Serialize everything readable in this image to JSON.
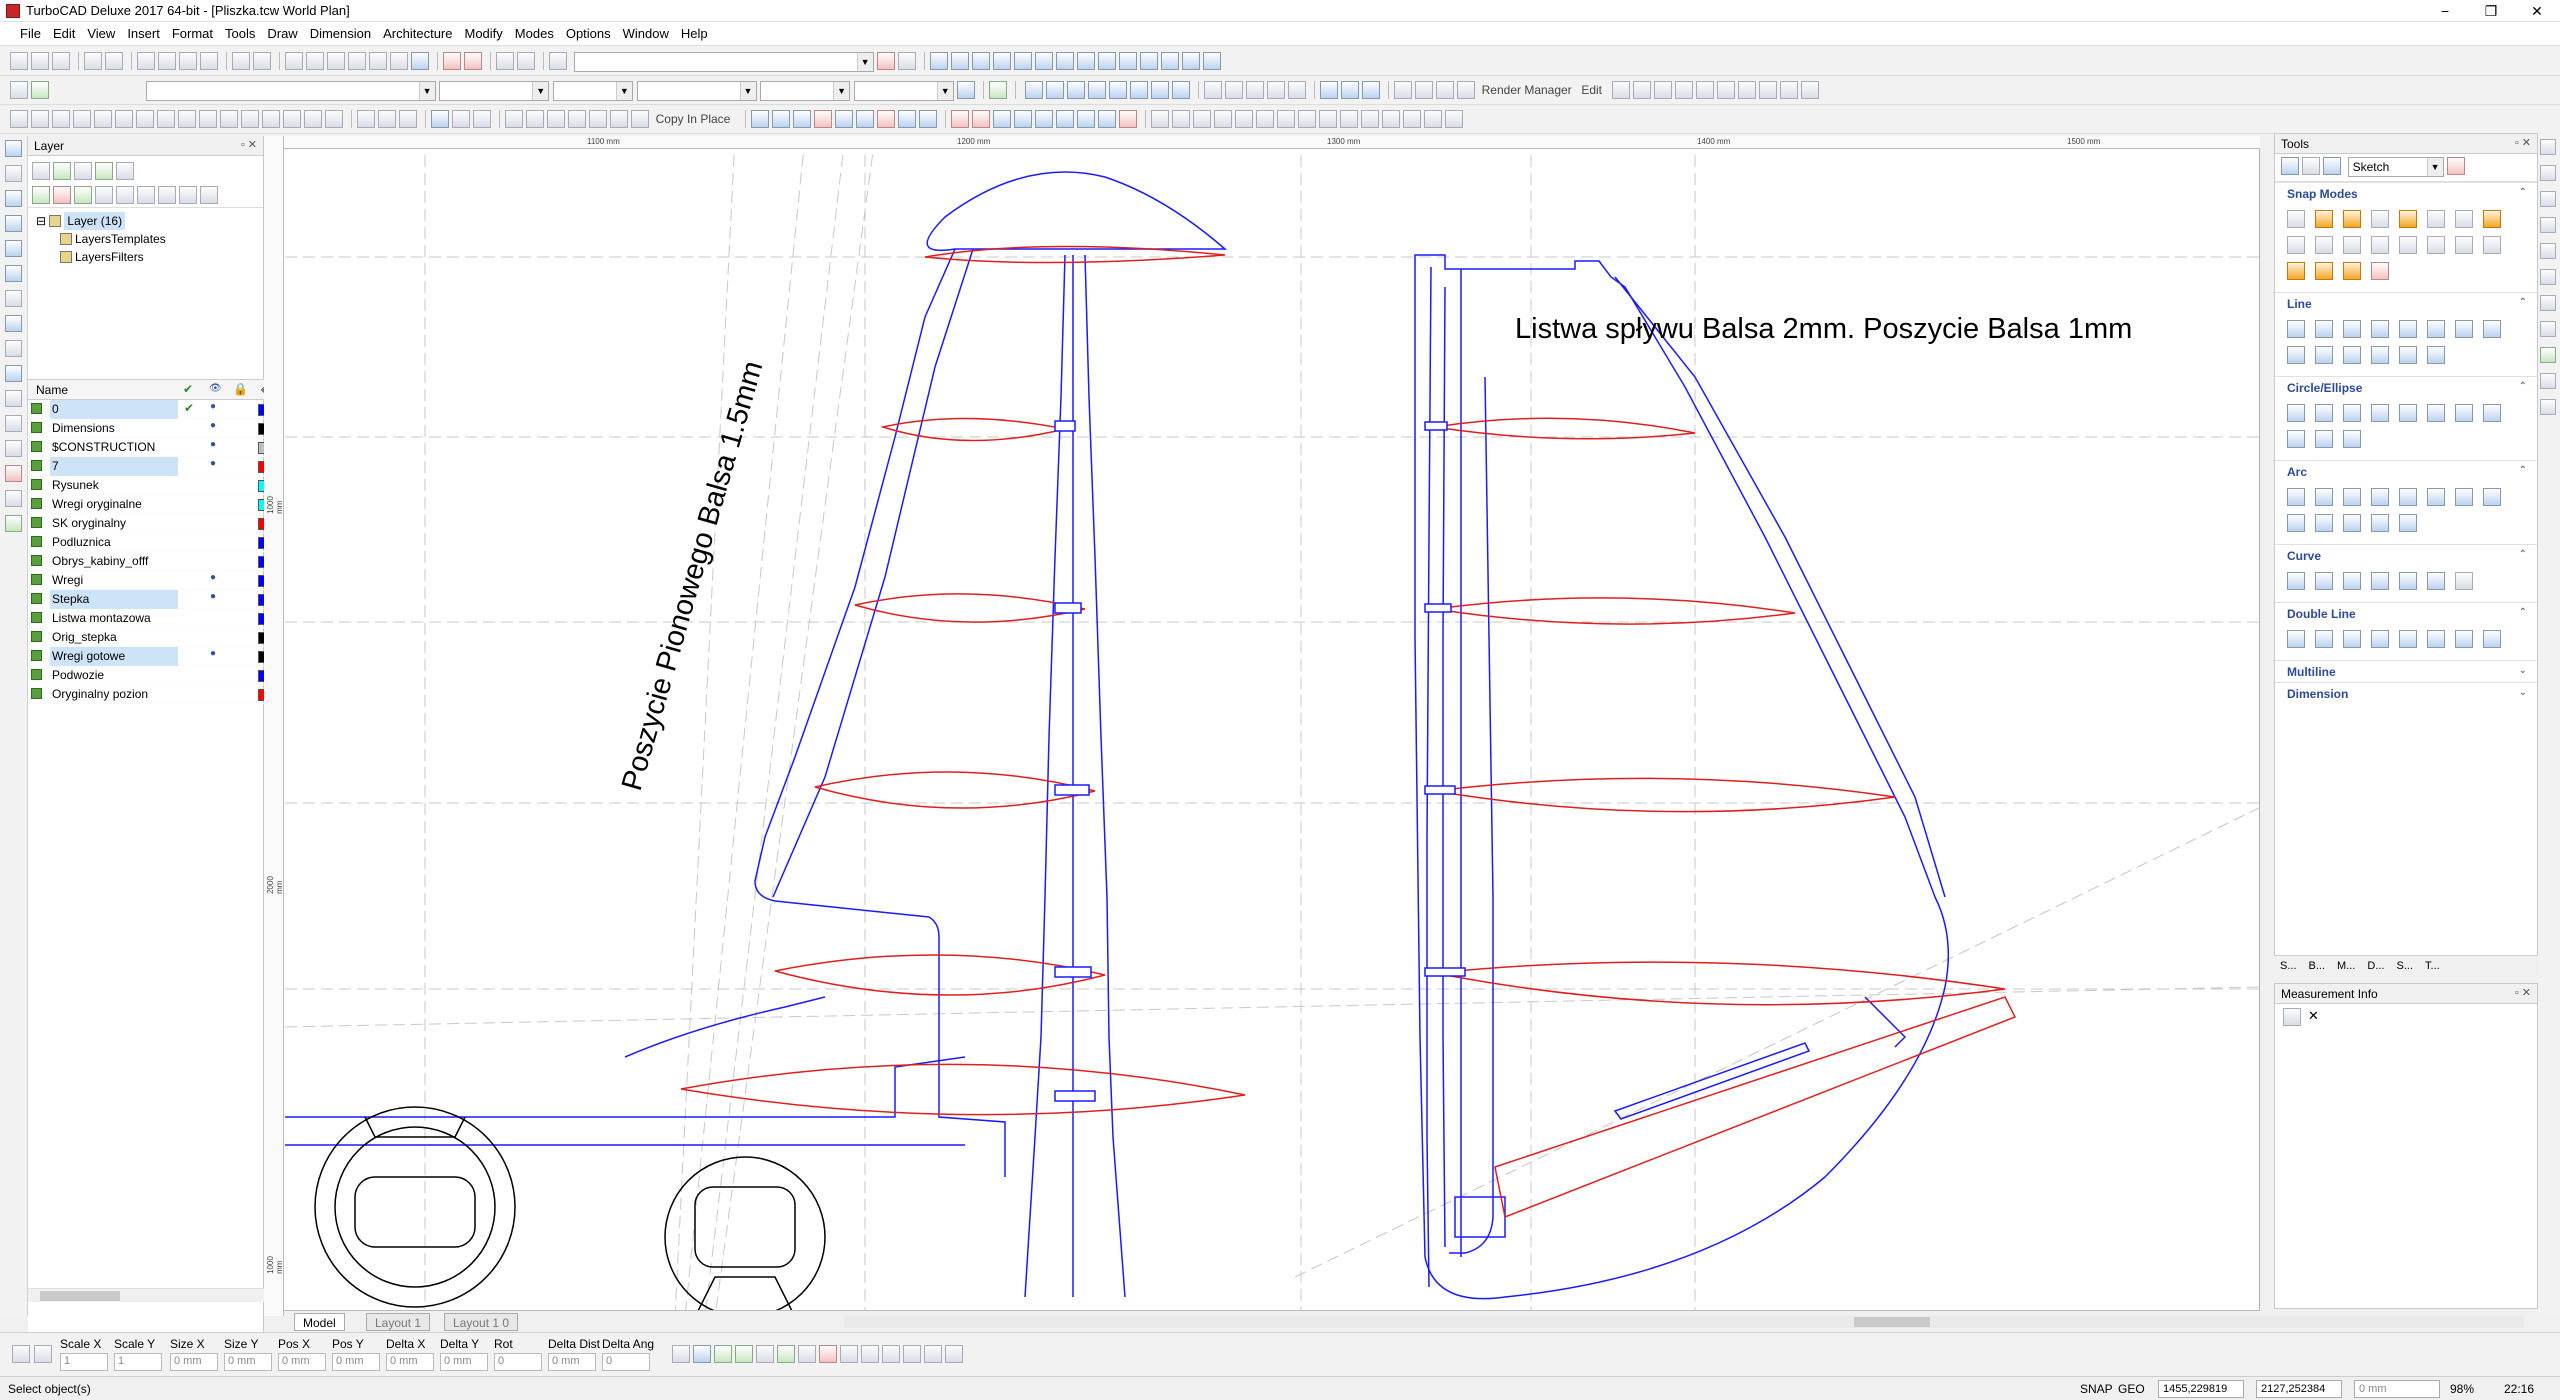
{
  "window": {
    "title": "TurboCAD Deluxe 2017 64-bit - [Pliszka.tcw World Plan]",
    "controls": [
      "−",
      "❐",
      "✕"
    ]
  },
  "menu": [
    "File",
    "Edit",
    "View",
    "Insert",
    "Format",
    "Tools",
    "Draw",
    "Dimension",
    "Architecture",
    "Modify",
    "Modes",
    "Options",
    "Window",
    "Help"
  ],
  "toolbars": {
    "render_manager_label": "Render Manager",
    "edit_label": "Edit",
    "copy_in_place_label": "Copy In Place"
  },
  "layer_panel": {
    "title": "Layer",
    "tree": {
      "root": "Layer (16)",
      "children": [
        "LayersTemplates",
        "LayersFilters"
      ]
    },
    "columns": {
      "name": "Name"
    },
    "layers": [
      {
        "name": "0",
        "checked": true,
        "visible": true,
        "color": "#0000ff",
        "highlight": true
      },
      {
        "name": "Dimensions",
        "checked": false,
        "visible": true,
        "color": "#000000",
        "highlight": false
      },
      {
        "name": "$CONSTRUCTION",
        "checked": false,
        "visible": true,
        "color": "#c0c0c0",
        "highlight": false
      },
      {
        "name": "7",
        "checked": false,
        "visible": true,
        "color": "#ff0000",
        "highlight": true
      },
      {
        "name": "Rysunek",
        "checked": false,
        "visible": false,
        "color": "#00ffff",
        "highlight": false
      },
      {
        "name": "Wregi oryginalne",
        "checked": false,
        "visible": false,
        "color": "#00ffff",
        "highlight": false
      },
      {
        "name": "SK oryginalny",
        "checked": false,
        "visible": false,
        "color": "#ff0000",
        "highlight": false
      },
      {
        "name": "Podluznica",
        "checked": false,
        "visible": false,
        "color": "#0000ff",
        "highlight": false
      },
      {
        "name": "Obrys_kabiny_offf",
        "checked": false,
        "visible": false,
        "color": "#0000ff",
        "highlight": false
      },
      {
        "name": "Wregi",
        "checked": false,
        "visible": true,
        "color": "#0000ff",
        "highlight": false
      },
      {
        "name": "Stepka",
        "checked": false,
        "visible": true,
        "color": "#0000ff",
        "highlight": true
      },
      {
        "name": "Listwa montazowa",
        "checked": false,
        "visible": false,
        "color": "#0000ff",
        "highlight": false
      },
      {
        "name": "Orig_stepka",
        "checked": false,
        "visible": false,
        "color": "#000000",
        "highlight": false
      },
      {
        "name": "Wregi gotowe",
        "checked": false,
        "visible": true,
        "color": "#000000",
        "highlight": true
      },
      {
        "name": "Podwozie",
        "checked": false,
        "visible": false,
        "color": "#0000ff",
        "highlight": false
      },
      {
        "name": "Oryginalny pozion",
        "checked": false,
        "visible": false,
        "color": "#ff0000",
        "highlight": false
      }
    ]
  },
  "drawing": {
    "annotation_right": "Listwa spływu Balsa 2mm. Poszycie Balsa 1mm",
    "annotation_rotated": "Poszycie Pionowego Balsa 1.5mm",
    "ruler_top": [
      "1100 mm",
      "1200 mm",
      "1300 mm",
      "1400 mm",
      "1500 mm"
    ],
    "ruler_left": [
      "1000 mm",
      "2000 mm",
      "1000 mm"
    ]
  },
  "tabs": [
    "Model",
    "Layout 1",
    "Layout 1 0"
  ],
  "tools_panel": {
    "title": "Tools",
    "mode_select": "Sketch",
    "sections": [
      "Snap Modes",
      "Line",
      "Circle/Ellipse",
      "Arc",
      "Curve",
      "Double Line",
      "Multiline",
      "Dimension"
    ],
    "bottom_tabs": [
      "S...",
      "B...",
      "M...",
      "D...",
      "S...",
      "T..."
    ]
  },
  "measurement": {
    "title": "Measurement Info"
  },
  "properties": [
    {
      "label": "Scale X",
      "value": "1"
    },
    {
      "label": "Scale Y",
      "value": "1"
    },
    {
      "label": "Size X",
      "value": "0 mm"
    },
    {
      "label": "Size Y",
      "value": "0 mm"
    },
    {
      "label": "Pos X",
      "value": "0 mm"
    },
    {
      "label": "Pos Y",
      "value": "0 mm"
    },
    {
      "label": "Delta X",
      "value": "0 mm"
    },
    {
      "label": "Delta Y",
      "value": "0 mm"
    },
    {
      "label": "Rot",
      "value": "0"
    },
    {
      "label": "Delta Dist",
      "value": "0 mm"
    },
    {
      "label": "Delta Ang",
      "value": "0"
    }
  ],
  "status": {
    "message": "Select object(s)",
    "snap": "SNAP",
    "geo": "GEO",
    "coord_x": "1455,229819",
    "coord_y": "2127,252384",
    "dist": "0 mm",
    "zoom": "98%",
    "time": "22:16"
  }
}
